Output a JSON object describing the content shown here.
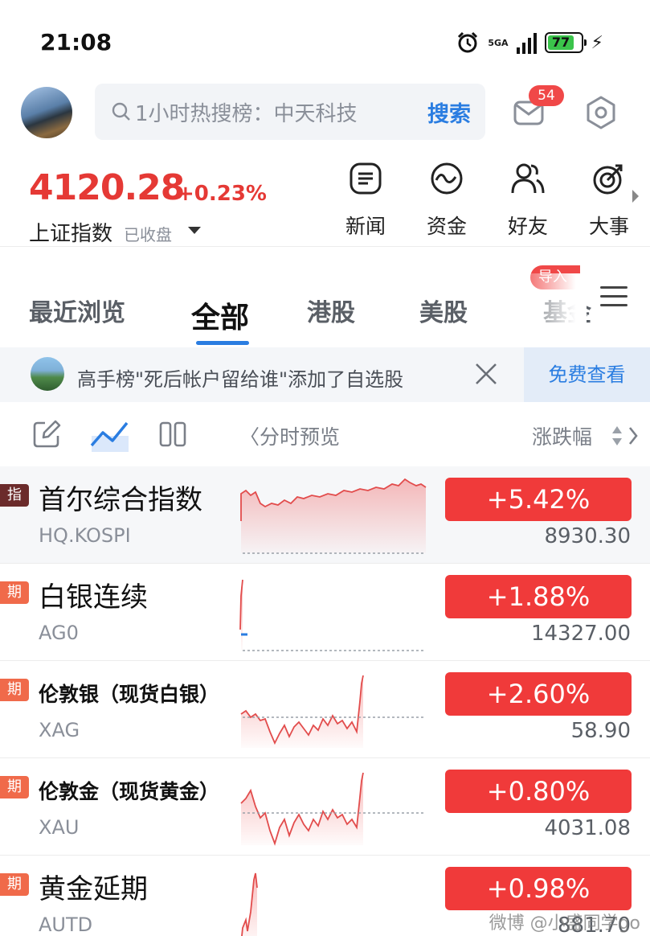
{
  "status_bar": {
    "time": "21:08",
    "network": "5GA",
    "battery": "77",
    "charging_icon": "bolt-icon"
  },
  "search": {
    "placeholder": "1小时热搜榜：中天科技",
    "button": "搜索"
  },
  "mail": {
    "badge": "54"
  },
  "index": {
    "value": "4120.28",
    "change": "+0.23%",
    "name": "上证指数",
    "status": "已收盘"
  },
  "quick_nav": [
    {
      "label": "新闻",
      "icon": "news-icon"
    },
    {
      "label": "资金",
      "icon": "fund-icon"
    },
    {
      "label": "好友",
      "icon": "friends-icon"
    },
    {
      "label": "大事",
      "icon": "events-icon"
    }
  ],
  "tabs": [
    {
      "label": "最近浏览"
    },
    {
      "label": "全部",
      "active": true
    },
    {
      "label": "港股"
    },
    {
      "label": "美股"
    },
    {
      "label": "基金"
    }
  ],
  "import_badge": "导入",
  "notice": {
    "text": "高手榜\"死后帐户留给谁\"添加了自选股",
    "action": "免费查看"
  },
  "toolbar": {
    "preview": "〈分时预览",
    "sort": "涨跌幅"
  },
  "colors": {
    "up": "#f03a3a",
    "accent": "#2a7de1",
    "tag_index": "#6b2b2b",
    "tag_futures": "#f06a4a"
  },
  "rows": [
    {
      "tag": "指",
      "name": "首尔综合指数",
      "code": "HQ.KOSPI",
      "change": "+5.42%",
      "price": "8930.30"
    },
    {
      "tag": "期",
      "name": "白银连续",
      "code": "AG0",
      "change": "+1.88%",
      "price": "14327.00"
    },
    {
      "tag": "期",
      "name": "伦敦银（现货白银）",
      "code": "XAG",
      "change": "+2.60%",
      "price": "58.90"
    },
    {
      "tag": "期",
      "name": "伦敦金（现货黄金）",
      "code": "XAU",
      "change": "+0.80%",
      "price": "4031.08"
    },
    {
      "tag": "期",
      "name": "黄金延期",
      "code": "AUTD",
      "change": "+0.98%",
      "price": "881.70"
    }
  ],
  "watermark": "微博 @小盛同学go"
}
